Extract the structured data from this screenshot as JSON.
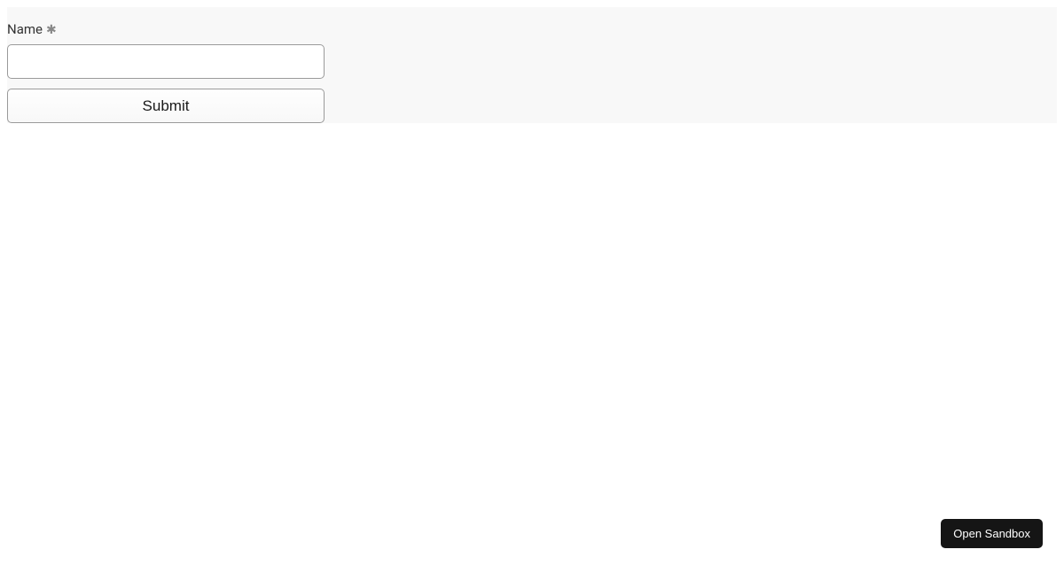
{
  "form": {
    "name_label": "Name",
    "required_mark": "✱",
    "name_value": "",
    "submit_label": "Submit"
  },
  "footer": {
    "open_sandbox_label": "Open Sandbox"
  }
}
